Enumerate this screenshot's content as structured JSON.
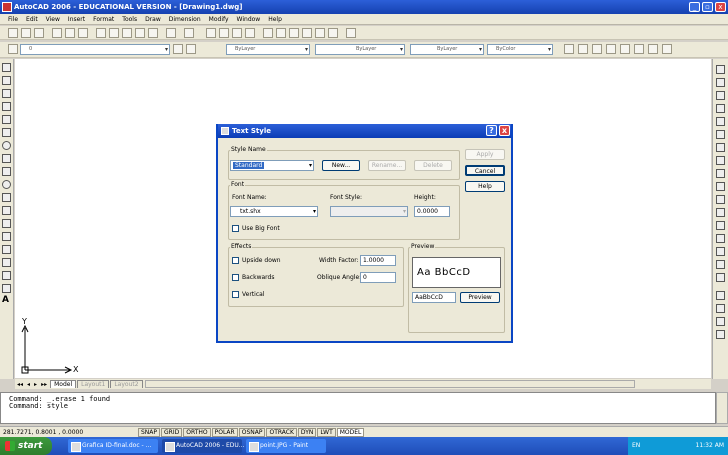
{
  "app": {
    "title": "AutoCAD 2006 - EDUCATIONAL VERSION - [Drawing1.dwg]",
    "window_controls": [
      "_",
      "▫",
      "x"
    ]
  },
  "menu": [
    "File",
    "Edit",
    "View",
    "Insert",
    "Format",
    "Tools",
    "Draw",
    "Dimension",
    "Modify",
    "Window",
    "Help"
  ],
  "properties": {
    "layer": "0",
    "color": "ByLayer",
    "linetype": "ByLayer",
    "lineweight": "ByLayer",
    "plotstyle": "ByColor"
  },
  "ucs": {
    "y": "Y",
    "x": "X"
  },
  "layout_tabs": [
    "Model",
    "Layout1",
    "Layout2"
  ],
  "nav_arrows": [
    "◂◂",
    "◂",
    "▸",
    "▸▸"
  ],
  "command_lines": [
    "Command:  _.erase 1 found",
    "Command:  style"
  ],
  "status": {
    "coords": "281.7271, 0.8001 , 0.0000",
    "buttons": [
      "SNAP",
      "GRID",
      "ORTHO",
      "POLAR",
      "OSNAP",
      "OTRACK",
      "DYN",
      "LWT",
      "MODEL"
    ]
  },
  "taskbar": {
    "start": "start",
    "tasks": [
      "Grafica ID-final.doc - ...",
      "AutoCAD 2006 - EDU...",
      "point.JPG - Paint"
    ],
    "lang": "EN",
    "time": "11:32 AM"
  },
  "dialog": {
    "title": "Text Style",
    "help_btn": "?",
    "close_btn": "x",
    "style_name_group": "Style Name",
    "style_name": "Standard",
    "new_btn": "New...",
    "rename_btn": "Rename...",
    "delete_btn": "Delete",
    "apply_btn": "Apply",
    "cancel_btn": "Cancel",
    "help_button": "Help",
    "font_group": "Font",
    "font_name_label": "Font Name:",
    "font_name": "txt.shx",
    "font_style_label": "Font Style:",
    "font_style": "",
    "height_label": "Height:",
    "height": "0.0000",
    "big_font_label": "Use Big Font",
    "effects_group": "Effects",
    "upside_down": "Upside down",
    "backwards": "Backwards",
    "vertical": "Vertical",
    "width_factor_label": "Width Factor:",
    "width_factor": "1.0000",
    "oblique_label": "Oblique Angle:",
    "oblique": "0",
    "preview_group": "Preview",
    "preview_sample": "Aa BbCcD",
    "preview_input": "AaBbCcD",
    "preview_btn": "Preview"
  }
}
